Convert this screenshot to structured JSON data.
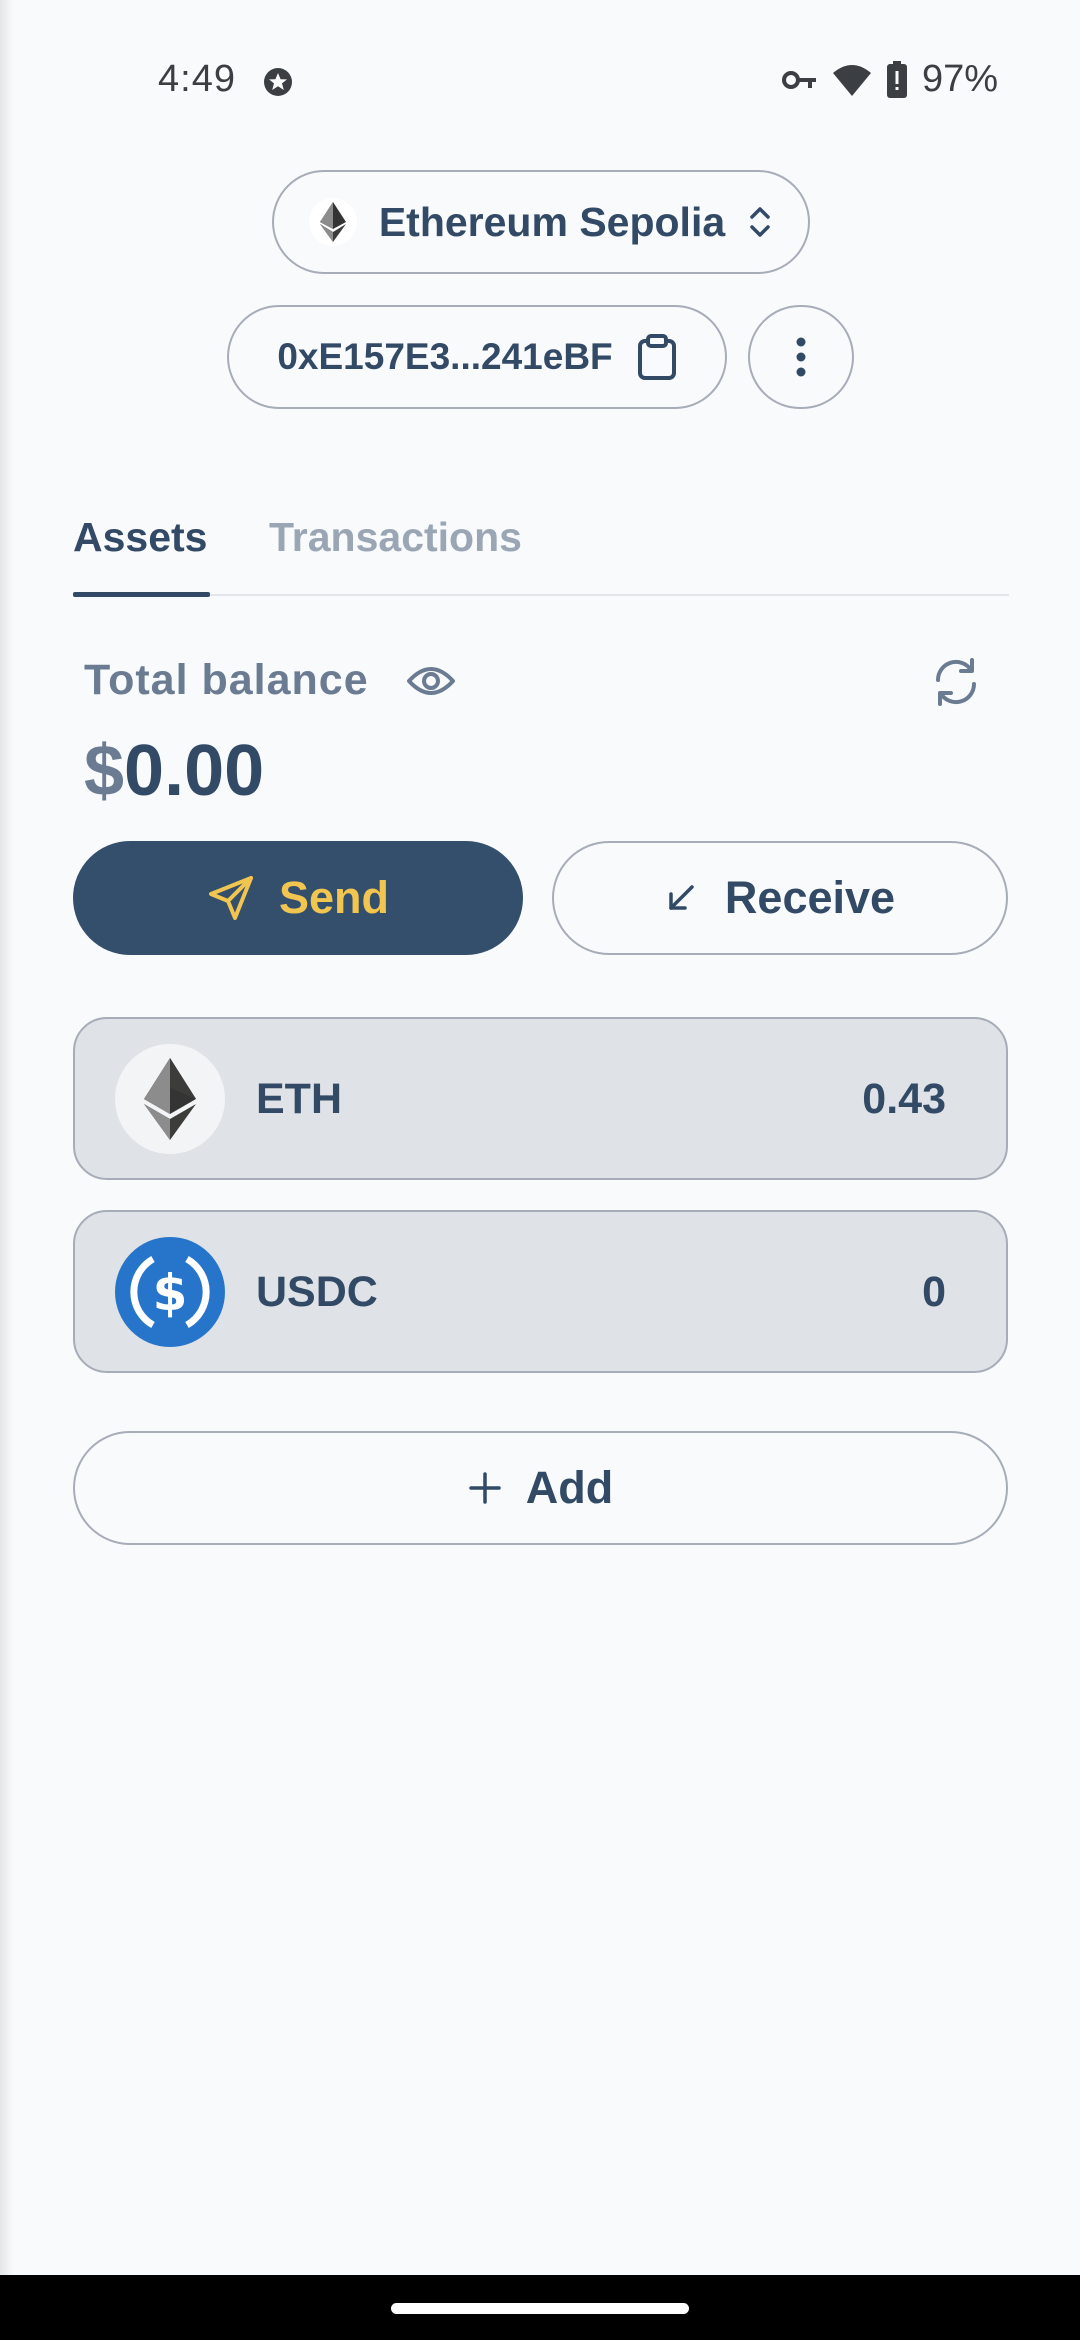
{
  "status_bar": {
    "time": "4:49",
    "battery": "97%",
    "icons": [
      "notification-icon",
      "vpn-key-icon",
      "wifi-icon",
      "battery-icon"
    ]
  },
  "header": {
    "network_name": "Ethereum Sepolia",
    "network_icon": "ethereum-logo",
    "address": "0xE157E3...241eBF"
  },
  "tabs": [
    {
      "label": "Assets",
      "active": true
    },
    {
      "label": "Transactions",
      "active": false
    }
  ],
  "balance": {
    "label": "Total balance",
    "currency": "$",
    "amount": "0.00"
  },
  "actions": {
    "send_label": "Send",
    "receive_label": "Receive",
    "add_label": "Add"
  },
  "assets": [
    {
      "symbol": "ETH",
      "amount": "0.43",
      "icon": "ethereum-logo"
    },
    {
      "symbol": "USDC",
      "amount": "0",
      "icon": "usdc-logo"
    }
  ],
  "colors": {
    "primary": "#334f6b",
    "accent": "#f1c54f",
    "muted": "#9ba6b5",
    "usdc": "#2775ca"
  }
}
